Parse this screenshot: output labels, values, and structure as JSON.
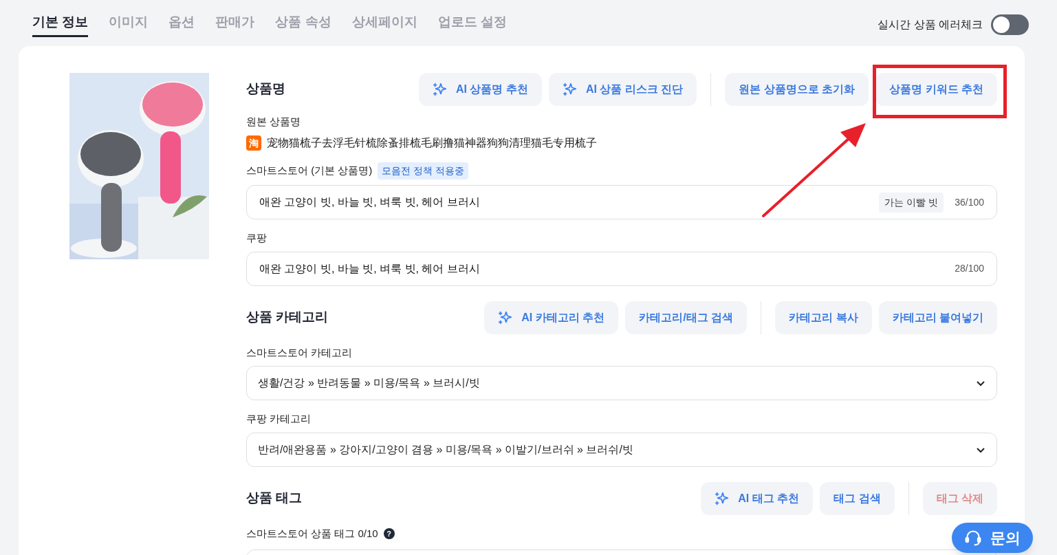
{
  "tabs": [
    {
      "label": "기본 정보",
      "selected": true
    },
    {
      "label": "이미지",
      "selected": false
    },
    {
      "label": "옵션",
      "selected": false
    },
    {
      "label": "판매가",
      "selected": false
    },
    {
      "label": "상품 속성",
      "selected": false
    },
    {
      "label": "상세페이지",
      "selected": false
    },
    {
      "label": "업로드 설정",
      "selected": false
    }
  ],
  "error_check": {
    "label": "실시간 상품 에러체크",
    "on": false
  },
  "sections": [
    {
      "title": "상품명",
      "button_groups": [
        [
          {
            "label": "AI 상품명 추천",
            "kind": "ai",
            "disabled": false
          },
          {
            "label": "AI 상품 리스크 진단",
            "kind": "ai",
            "disabled": false
          }
        ],
        [
          {
            "label": "원본 상품명으로 초기화",
            "kind": "plain",
            "disabled": false
          },
          {
            "label": "상품명 키워드 추천",
            "kind": "plain",
            "disabled": false
          }
        ]
      ],
      "fields": [
        {
          "kind": "source",
          "label": "원본 상품명",
          "badge": "淘",
          "value": "宠物猫梳子去浮毛针梳除蚤排梳毛刷撸猫神器狗狗清理猫毛专用梳子"
        },
        {
          "kind": "text",
          "label": "스마트스토어 (기본 상품명)",
          "tag": "모음전 정책 적용중",
          "value": "애완 고양이 빗, 바늘 빗, 벼룩 빗, 헤어 브러시",
          "chip": "가는 이빨 빗",
          "counter": "36/100"
        },
        {
          "kind": "text",
          "label": "쿠팡",
          "value": "애완 고양이 빗, 바늘 빗, 벼룩 빗, 헤어 브러시",
          "counter": "28/100"
        }
      ]
    },
    {
      "title": "상품 카테고리",
      "button_groups": [
        [
          {
            "label": "AI 카테고리 추천",
            "kind": "ai",
            "disabled": false
          },
          {
            "label": "카테고리/태그 검색",
            "kind": "plain",
            "disabled": false
          }
        ],
        [
          {
            "label": "카테고리 복사",
            "kind": "plain",
            "disabled": false
          },
          {
            "label": "카테고리 붙여넣기",
            "kind": "plain",
            "disabled": false
          }
        ]
      ],
      "fields": [
        {
          "kind": "select",
          "label": "스마트스토어 카테고리",
          "value": "생활/건강 » 반려동물 » 미용/목욕 » 브러시/빗"
        },
        {
          "kind": "select",
          "label": "쿠팡 카테고리",
          "value": "반려/애완용품 » 강아지/고양이 겸용 » 미용/목욕 » 이발기/브러쉬 » 브러쉬/빗"
        }
      ]
    },
    {
      "title": "상품 태그",
      "button_groups": [
        [
          {
            "label": "AI 태그 추천",
            "kind": "ai",
            "disabled": false
          },
          {
            "label": "태그 검색",
            "kind": "plain",
            "disabled": false
          }
        ],
        [
          {
            "label": "태그 삭제",
            "kind": "plain",
            "disabled": true
          }
        ]
      ],
      "fields": [
        {
          "kind": "tags",
          "label": "스마트스토어 상품 태그 0/10",
          "help": "?"
        }
      ]
    }
  ],
  "annotation": {
    "kind": "highlight"
  },
  "contact_button": {
    "label": "문의"
  }
}
